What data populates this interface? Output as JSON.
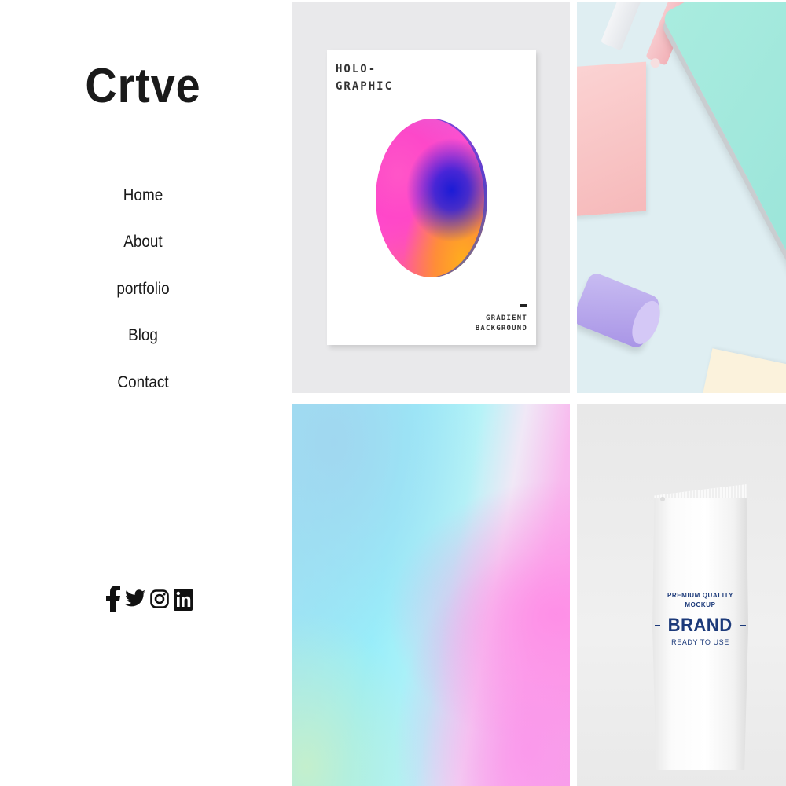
{
  "site": {
    "logo": "Crtve"
  },
  "nav": {
    "items": [
      {
        "label": "Home"
      },
      {
        "label": "About"
      },
      {
        "label": "portfolio"
      },
      {
        "label": "Blog"
      },
      {
        "label": "Contact"
      }
    ]
  },
  "social": {
    "icons": [
      "facebook-icon",
      "twitter-icon",
      "instagram-icon",
      "linkedin-icon"
    ]
  },
  "gallery": {
    "poster": {
      "title_line1": "HOLO-",
      "title_line2": "GRAPHIC",
      "sub_line1": "GRADIENT",
      "sub_line2": "BACKGROUND"
    },
    "pouch": {
      "line1": "PREMIUM QUALITY",
      "line2": "MOCKUP",
      "brand": "BRAND",
      "tagline": "READY TO USE"
    }
  },
  "colors": {
    "text": "#1a1a1a",
    "pouch_text": "#1c3a7a",
    "poster_bg": "#e9e9eb"
  }
}
